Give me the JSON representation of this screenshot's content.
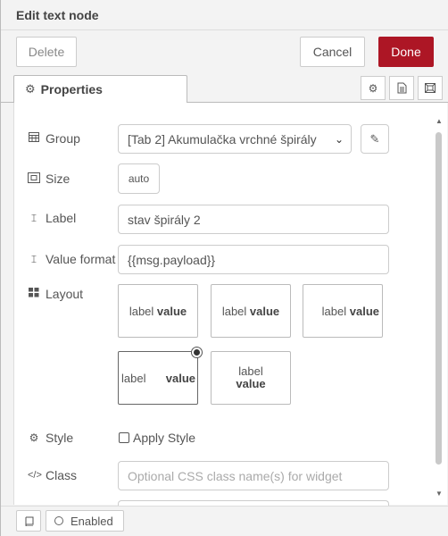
{
  "header": {
    "title": "Edit text node"
  },
  "toolbar": {
    "delete_label": "Delete",
    "cancel_label": "Cancel",
    "done_label": "Done"
  },
  "tabs": {
    "properties_label": "Properties"
  },
  "form": {
    "group": {
      "label": "Group",
      "value": "[Tab 2] Akumulačka vrchné špirály"
    },
    "size": {
      "label": "Size",
      "value": "auto"
    },
    "label_field": {
      "label": "Label",
      "value": "stav špirály 2"
    },
    "value_format": {
      "label": "Value format",
      "value": "{{msg.payload}}"
    },
    "layout": {
      "label": "Layout",
      "options": [
        {
          "label": "label",
          "value": "value"
        },
        {
          "label": "label",
          "value": "value"
        },
        {
          "label": "label",
          "value": "value"
        },
        {
          "label": "label",
          "value": "value"
        },
        {
          "label": "label",
          "value": "value"
        }
      ],
      "selected_index": 3
    },
    "style": {
      "label": "Style",
      "checkbox_label": "Apply Style",
      "checked": false
    },
    "class": {
      "label": "Class",
      "placeholder": "Optional CSS class name(s) for widget"
    }
  },
  "footer": {
    "enabled_label": "Enabled"
  },
  "icons": {
    "properties_tab": "gear-icon",
    "side_tabs": [
      "gear-icon",
      "description-icon",
      "appearance-icon"
    ],
    "group": "table-icon",
    "size": "resize-icon",
    "label": "text-cursor-icon",
    "value_format": "text-cursor-icon",
    "layout": "grid-icon",
    "style": "gear-icon",
    "class": "code-icon",
    "edit": "pencil-icon",
    "footer_book": "book-icon"
  },
  "colors": {
    "done_button": "#AD1625"
  }
}
